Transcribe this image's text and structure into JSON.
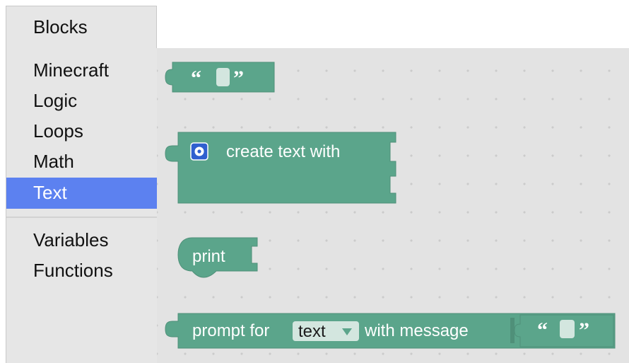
{
  "toolbox": {
    "header": "Blocks",
    "categories": [
      {
        "label": "Minecraft"
      },
      {
        "label": "Logic"
      },
      {
        "label": "Loops"
      },
      {
        "label": "Math"
      },
      {
        "label": "Text",
        "selected": true
      },
      {
        "label": "Variables"
      },
      {
        "label": "Functions"
      }
    ]
  },
  "flyout": {
    "text_block": {
      "open_quote": "“",
      "close_quote": "”"
    },
    "create_text_block": {
      "label": "create text with",
      "icon": "gear-icon"
    },
    "print_block": {
      "label": "print"
    },
    "prompt_block": {
      "prefix": "prompt for",
      "dropdown_value": "text",
      "suffix": "with message",
      "open_quote": "“",
      "close_quote": "”"
    }
  },
  "colors": {
    "block": "#5ba58b",
    "block_dark": "#4f9079",
    "text_field": "#d3e6df",
    "selected_category": "#5c81f0",
    "toolbox_bg": "#e6e6e6",
    "workspace_bg": "#e3e3e3"
  }
}
